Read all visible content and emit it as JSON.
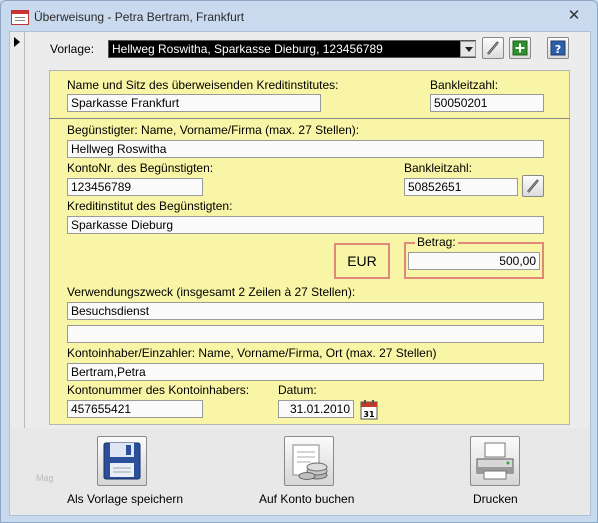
{
  "window": {
    "title": "Überweisung - Petra Bertram, Frankfurt",
    "close_glyph": "✕"
  },
  "vorlage": {
    "label": "Vorlage:",
    "value": "Hellweg Roswitha, Sparkasse Dieburg, 123456789"
  },
  "bank_sender": {
    "name_label": "Name und Sitz des überweisenden Kreditinstitutes:",
    "name_value": "Sparkasse Frankfurt",
    "blz_label": "Bankleitzahl:",
    "blz_value": "50050201"
  },
  "beneficiary": {
    "name_label": "Begünstigter: Name, Vorname/Firma (max. 27 Stellen):",
    "name_value": "Hellweg Roswitha",
    "account_label": "KontoNr. des Begünstigten:",
    "account_value": "123456789",
    "blz_label": "Bankleitzahl:",
    "blz_value": "50852651",
    "bank_label": "Kreditinstitut des Begünstigten:",
    "bank_value": "Sparkasse Dieburg"
  },
  "amount": {
    "currency": "EUR",
    "label": "Betrag:",
    "value": "500,00"
  },
  "purpose": {
    "label": "Verwendungszweck (insgesamt 2 Zeilen à 27 Stellen):",
    "line1": "Besuchsdienst",
    "line2": ""
  },
  "payer": {
    "name_label": "Kontoinhaber/Einzahler: Name, Vorname/Firma, Ort (max. 27 Stellen)",
    "name_value": "Bertram,Petra",
    "account_label": "Kontonummer des Kontoinhabers:",
    "account_value": "457655421",
    "date_label": "Datum:",
    "date_value": "31.01.2010",
    "calendar_day": "31"
  },
  "actions": {
    "save_template": "Als Vorlage speichern",
    "book": "Auf Konto buchen",
    "print": "Drucken",
    "watermark": "Mag"
  },
  "icons": [
    "form-icon",
    "close-icon",
    "record-selector-icon",
    "dropdown-icon",
    "pencil-icon",
    "add-icon",
    "help-icon",
    "calendar-icon",
    "floppy-disk-icon",
    "coins-icon",
    "printer-icon"
  ],
  "colors": {
    "form_background": "#f9f5a6",
    "highlight_border": "#e0887a",
    "window_background": "#c9daef"
  }
}
